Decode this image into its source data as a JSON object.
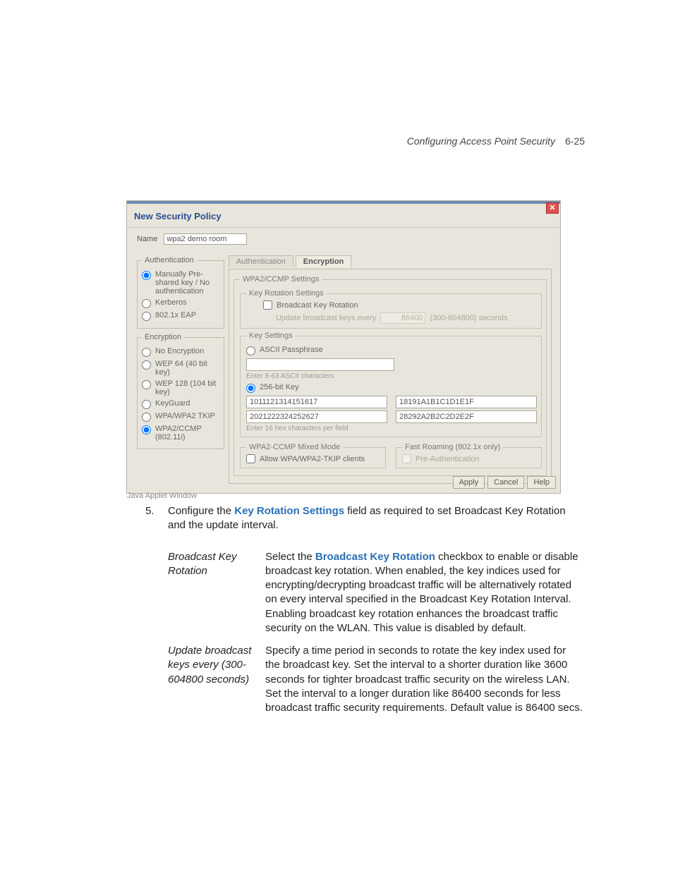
{
  "header": {
    "title": "Configuring Access Point Security",
    "page": "6-25"
  },
  "window": {
    "title": "New Security Policy",
    "name_label": "Name",
    "name_value": "wpa2 demo room",
    "auth": {
      "legend": "Authentication",
      "options": {
        "manual": "Manually Pre-shared key / No authentication",
        "kerberos": "Kerberos",
        "eap": "802.1x EAP"
      },
      "selected": "manual"
    },
    "enc": {
      "legend": "Encryption",
      "options": {
        "none": "No Encryption",
        "wep64": "WEP 64 (40 bit key)",
        "wep128": "WEP 128 (104 bit key)",
        "keyguard": "KeyGuard",
        "wpa_tkip": "WPA/WPA2 TKIP",
        "wpa2_ccmp": "WPA2/CCMP (802.11i)"
      },
      "selected": "wpa2_ccmp"
    },
    "tabs": {
      "auth": "Authentication",
      "enc": "Encryption",
      "active": "enc"
    },
    "settings": {
      "legend": "WPA2/CCMP Settings",
      "rotation": {
        "legend": "Key Rotation Settings",
        "bkr_label": "Broadcast Key Rotation",
        "update_label": "Update broadcast keys every",
        "value": "86400",
        "range": "(300-604800) seconds"
      },
      "keys": {
        "legend": "Key Settings",
        "ascii_label": "ASCII Passphrase",
        "ascii_hint": "Enter 8-63 ASCII characters",
        "b256_label": "256-bit Key",
        "k1": "1011121314151617",
        "k2": "18191A1B1C1D1E1F",
        "k3": "2021222324252627",
        "k4": "28292A2B2C2D2E2F",
        "hex_hint": "Enter 16 hex characters per field"
      },
      "mixed": {
        "legend": "WPA2-CCMP Mixed Mode",
        "allow_label": "Allow WPA/WPA2-TKIP clients"
      },
      "fastroam": {
        "legend": "Fast Roaming (802.1x only)",
        "preauth_label": "Pre-Authentication"
      }
    },
    "buttons": {
      "apply": "Apply",
      "cancel": "Cancel",
      "help": "Help"
    },
    "status": "Java Applet Window"
  },
  "body": {
    "step_num": "5.",
    "step_text_a": "Configure the ",
    "step_kw": "Key Rotation Settings",
    "step_text_b": " field as required to set Broadcast Key Rotation and the update interval.",
    "rows": [
      {
        "term": "Broadcast Key Rotation",
        "def_a": "Select the ",
        "def_kw": "Broadcast Key Rotation",
        "def_b": " checkbox to enable or disable broadcast key rotation. When enabled, the key indices used for encrypting/decrypting broadcast traffic will be alternatively rotated on every interval specified in the Broadcast Key Rotation Interval. Enabling broadcast key rotation enhances the broadcast traffic security on the WLAN. This value is disabled by default."
      },
      {
        "term": "Update broadcast keys every (300-604800 seconds)",
        "def_a": "",
        "def_kw": "",
        "def_b": "Specify a time period in seconds to rotate the key index used for the broadcast key. Set the interval to a shorter duration like 3600 seconds for tighter broadcast traffic security on the wireless LAN. Set the interval to a longer duration like 86400 seconds for less broadcast traffic security requirements. Default value is 86400 secs."
      }
    ]
  }
}
